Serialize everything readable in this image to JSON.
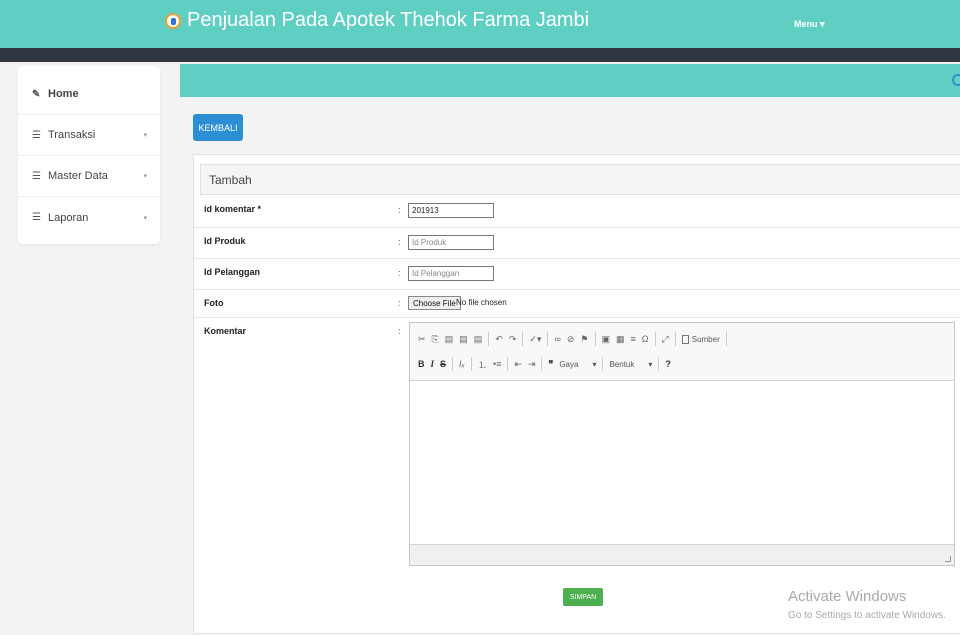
{
  "header": {
    "title": "Penjualan Pada Apotek Thehok Farma Jambi",
    "menu": "Menu ▾"
  },
  "sidebar": {
    "items": [
      {
        "label": "Home",
        "icon": "✎"
      },
      {
        "label": "Transaksi",
        "icon": "☰",
        "chevron": "▾"
      },
      {
        "label": "Master Data",
        "icon": "☰",
        "chevron": "▾"
      },
      {
        "label": "Laporan",
        "icon": "☰",
        "chevron": "▾"
      }
    ]
  },
  "actions": {
    "back": "KEMBALI",
    "save": "SIMPAN"
  },
  "panel": {
    "title": "Tambah"
  },
  "form": {
    "id_komentar": {
      "label": "id komentar *",
      "value": "201913"
    },
    "id_produk": {
      "label": "Id Produk",
      "placeholder": "Id Produk"
    },
    "id_pelanggan": {
      "label": "Id Pelanggan",
      "placeholder": "Id Pelanggan"
    },
    "foto": {
      "label": "Foto",
      "button": "Choose File",
      "status": "No file chosen"
    },
    "komentar": {
      "label": "Komentar"
    },
    "colon": ":"
  },
  "editor": {
    "source": "Sumber",
    "style": "Gaya",
    "format": "Bentuk",
    "help": "?",
    "dropdown": "▾"
  },
  "watermark": {
    "line1": "Activate Windows",
    "line2": "Go to Settings to activate Windows."
  },
  "colors": {
    "teal": "#5fcfc3",
    "dark": "#2f3640",
    "blue": "#2c8fd6",
    "green": "#4caf50"
  }
}
